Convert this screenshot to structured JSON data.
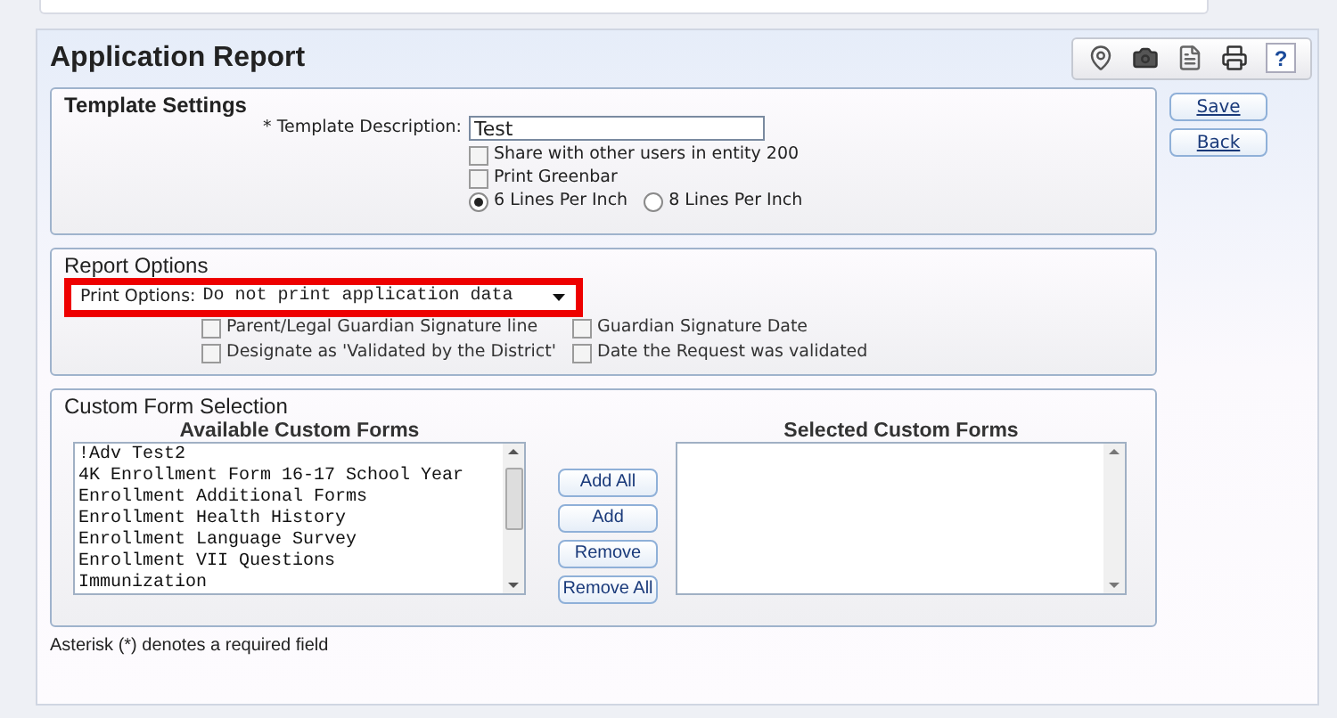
{
  "page": {
    "title": "Application Report"
  },
  "toolbar": [
    {
      "kind": "map"
    },
    {
      "kind": "camera"
    },
    {
      "kind": "document"
    },
    {
      "kind": "print"
    },
    {
      "kind": "help",
      "label": "?"
    }
  ],
  "actions": [
    {
      "label": "Save"
    },
    {
      "label": "Back"
    }
  ],
  "template_settings": {
    "title": "Template Settings",
    "description_label": "* Template Description:",
    "description_value": "Test",
    "checkboxes": [
      {
        "label": "Share with other users in entity 200",
        "checked": false
      },
      {
        "label": "Print Greenbar",
        "checked": false
      }
    ],
    "radios": [
      {
        "label": "6 Lines Per Inch",
        "selected": true
      },
      {
        "label": "8 Lines Per Inch",
        "selected": false
      }
    ]
  },
  "report_options": {
    "title": "Report Options",
    "print_options_label": "Print Options:",
    "print_options_value": "Do not print application data",
    "highlighted": true,
    "checkboxes": [
      {
        "label": "Parent/Legal Guardian Signature line",
        "checked": false
      },
      {
        "label": "Guardian Signature Date",
        "checked": false
      },
      {
        "label": "Designate as 'Validated by the District'",
        "checked": false
      },
      {
        "label": "Date the Request was validated",
        "checked": false
      }
    ]
  },
  "custom_forms": {
    "title": "Custom Form Selection",
    "available_title": "Available Custom Forms",
    "selected_title": "Selected Custom Forms",
    "available": [
      {
        "label": "!Adv Test2",
        "selected": false
      },
      {
        "label": "4K Enrollment Form 16-17 School Year",
        "selected": false
      },
      {
        "label": "Enrollment Additional Forms",
        "selected": false
      },
      {
        "label": "Enrollment Health History",
        "selected": false
      },
      {
        "label": "Enrollment Language Survey",
        "selected": false
      },
      {
        "label": "Enrollment VII Questions",
        "selected": false
      },
      {
        "label": "Immunization",
        "selected": false
      }
    ],
    "buttons": [
      {
        "label": "Add All"
      },
      {
        "label": "Add"
      },
      {
        "label": "Remove"
      },
      {
        "label": "Remove All"
      }
    ]
  },
  "footnote": "Asterisk (*) denotes a required field"
}
